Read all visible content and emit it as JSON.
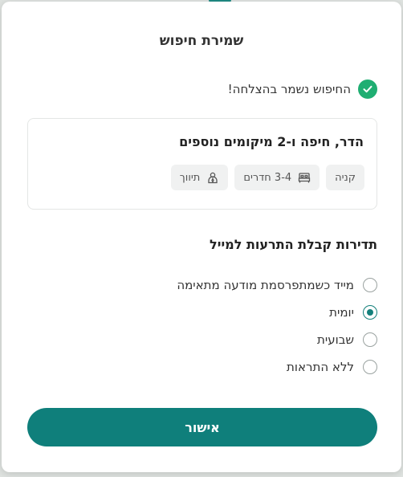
{
  "modal": {
    "title": "שמירת חיפוש",
    "success_message": "החיפוש נשמר בהצלחה!"
  },
  "search_card": {
    "title": "הדר, חיפה ו-2 מיקומים נוספים",
    "chips": [
      {
        "label": "קניה",
        "icon": ""
      },
      {
        "label": "3-4 חדרים",
        "icon": "bed-icon"
      },
      {
        "label": "תיווך",
        "icon": "agent-icon"
      }
    ]
  },
  "alerts": {
    "title": "תדירות קבלת התרעות למייל",
    "options": [
      {
        "label": "מייד כשמתפרסמת מודעה מתאימה",
        "selected": false
      },
      {
        "label": "יומית",
        "selected": true
      },
      {
        "label": "שבועית",
        "selected": false
      },
      {
        "label": "ללא התראות",
        "selected": false
      }
    ]
  },
  "actions": {
    "confirm_label": "אישור"
  },
  "colors": {
    "accent": "#0f7f7b",
    "success": "#1fae72"
  }
}
